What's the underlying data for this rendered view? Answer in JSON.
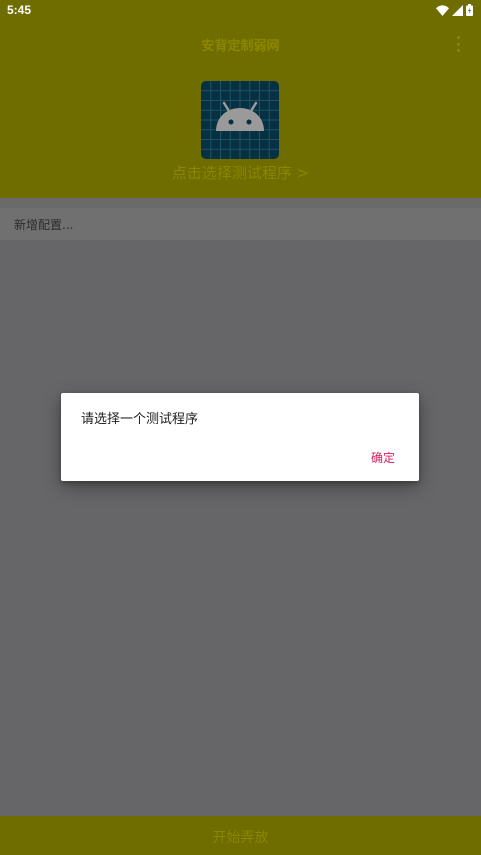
{
  "status_bar": {
    "time": "5:45",
    "icons": [
      "wifi-icon",
      "signal-icon",
      "battery-icon"
    ]
  },
  "app_bar": {
    "title": "安背定制弱网",
    "select_app": "点击选择测试程序 >"
  },
  "config": {
    "add_label": "新增配置..."
  },
  "bottom": {
    "start_label": "开始弄放"
  },
  "dialog": {
    "message": "请选择一个测试程序",
    "ok_label": "确定"
  },
  "colors": {
    "app_bar_dimmed": "#6f6c00",
    "title_text_dimmed": "#8a8700",
    "dialog_button": "#d81b60",
    "scrim_content": "#666668"
  }
}
